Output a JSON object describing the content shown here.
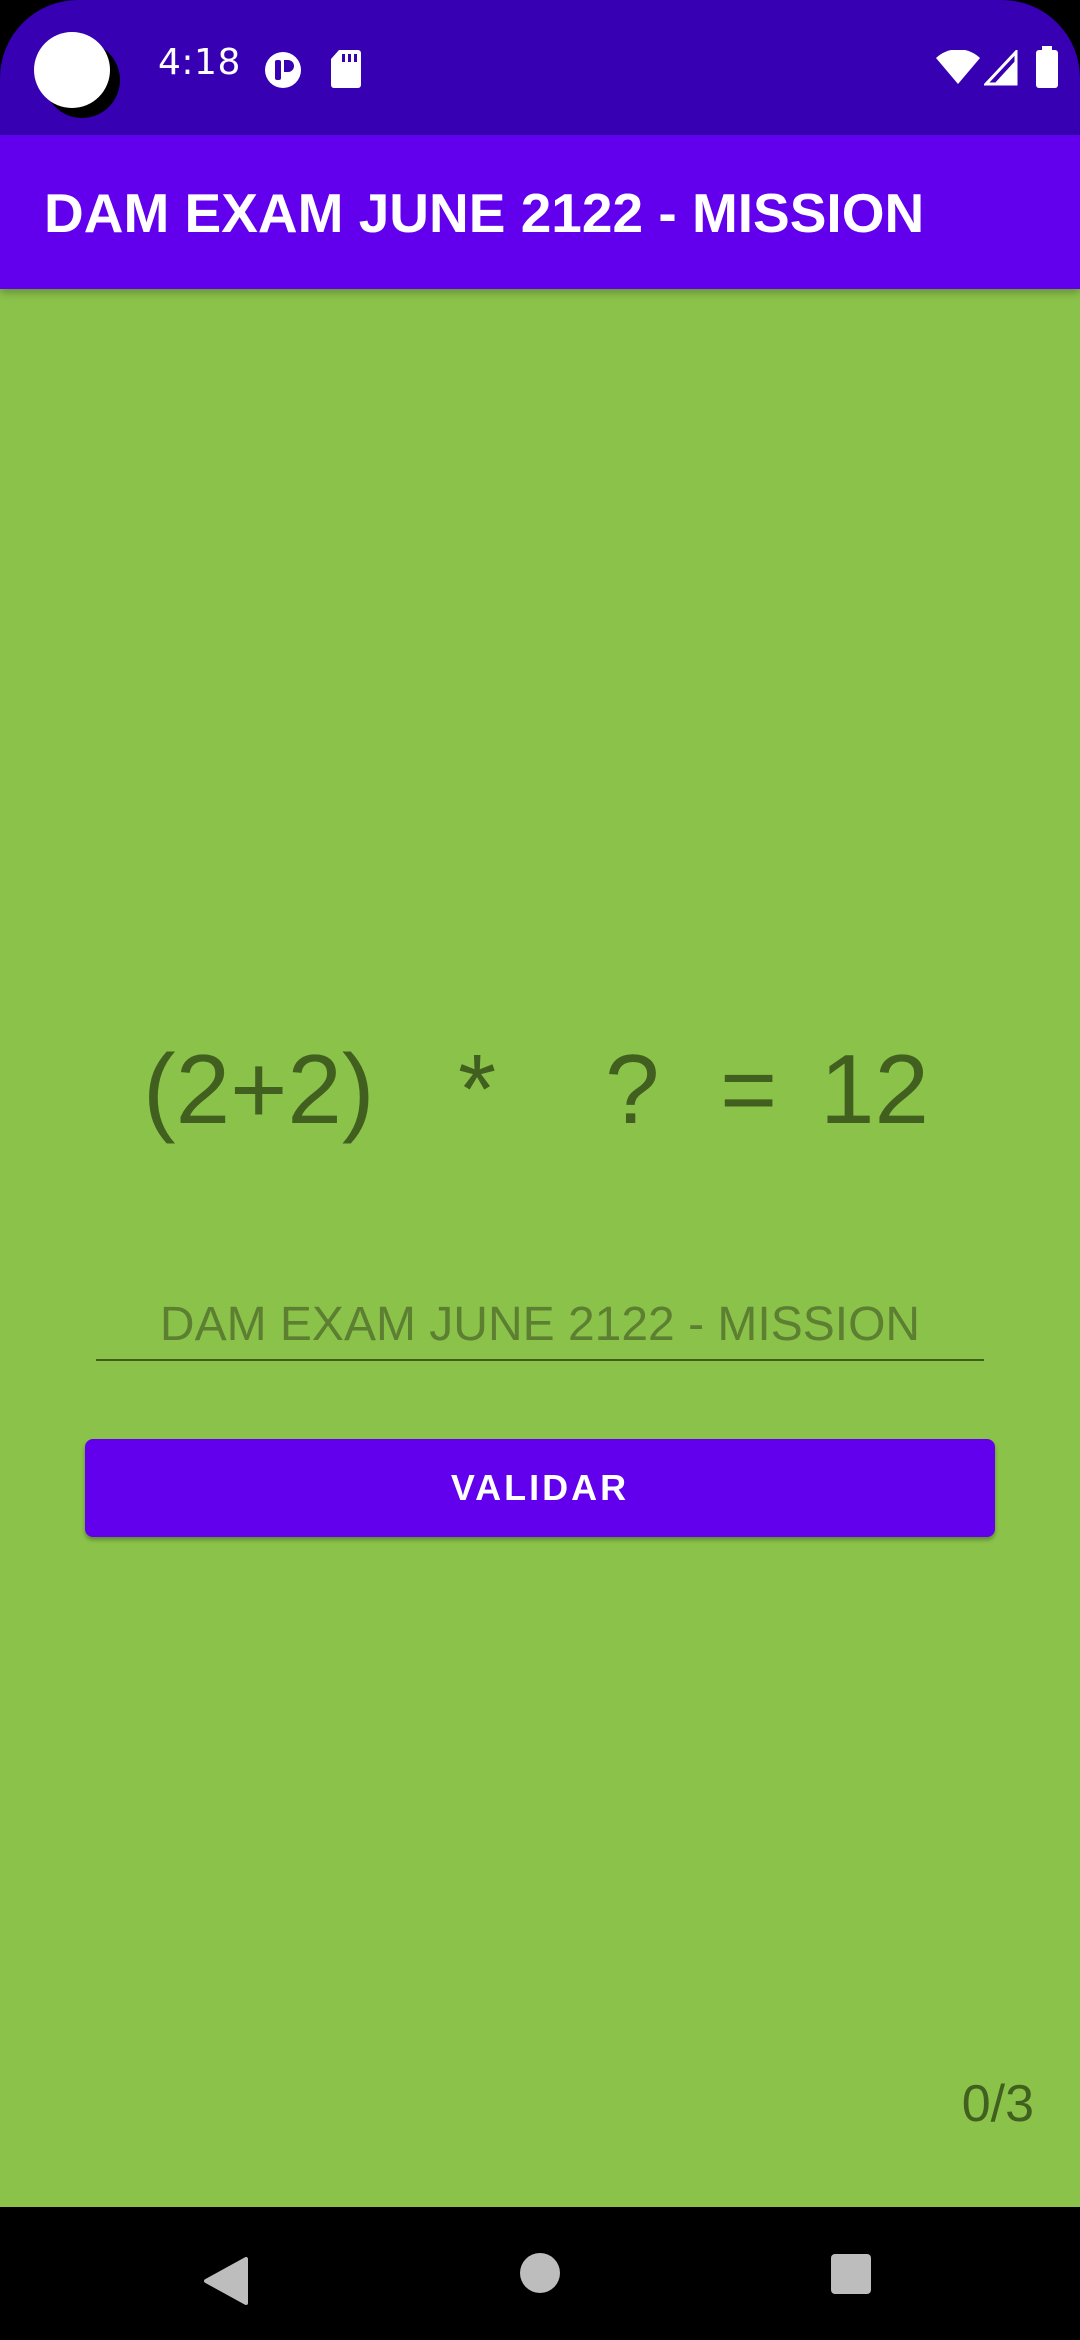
{
  "status_bar": {
    "time": "4:18",
    "icons": [
      "camera-dot",
      "app-notification-icon",
      "sd-card-icon",
      "wifi-icon",
      "signal-icon",
      "battery-icon"
    ]
  },
  "app_bar": {
    "title": "DAM EXAM JUNE 2122 - MISSION"
  },
  "equation": {
    "left_operand": "(2+2)",
    "operator": "*",
    "unknown": "?",
    "equals": "=",
    "result": "12"
  },
  "answer_input": {
    "value": "",
    "placeholder": "DAM EXAM JUNE 2122 - MISSION"
  },
  "validate_button": {
    "label": "VALIDAR"
  },
  "progress": {
    "counter": "0/3"
  },
  "nav_bar": {
    "icons": [
      "back-icon",
      "home-icon",
      "recents-icon"
    ]
  },
  "colors": {
    "status_bar": "#3700B3",
    "app_bar": "#6200EE",
    "content_background": "#8BC34A",
    "equation_text": "#41601F",
    "button": "#6200EE"
  }
}
